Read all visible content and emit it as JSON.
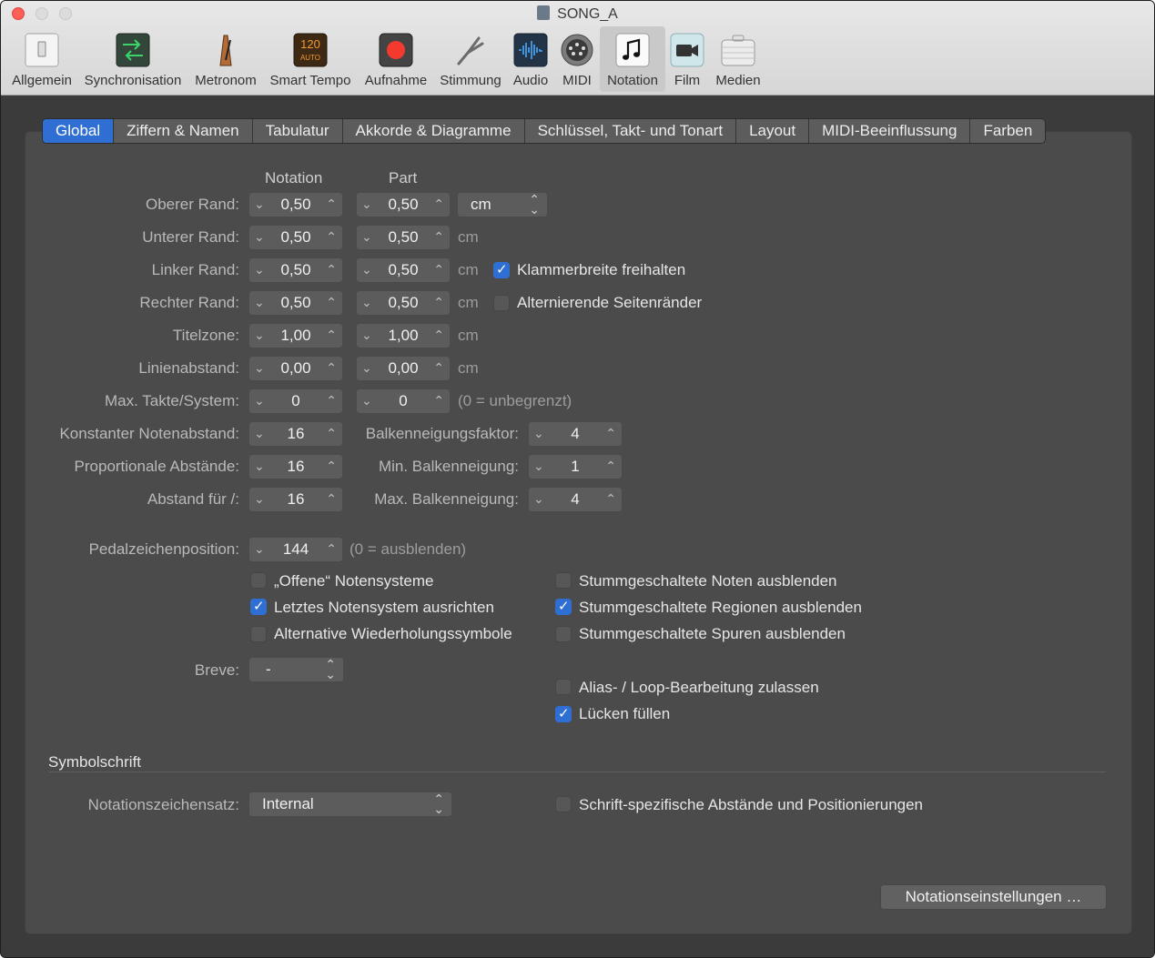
{
  "window": {
    "title": "SONG_A"
  },
  "toolbar": {
    "items": [
      {
        "label": "Allgemein",
        "icon": "general-switch-icon"
      },
      {
        "label": "Synchronisation",
        "icon": "sync-arrows-icon"
      },
      {
        "label": "Metronom",
        "icon": "metronome-icon"
      },
      {
        "label": "Smart Tempo",
        "icon": "smart-tempo-icon",
        "icon_text": "120",
        "icon_subtext": "AUTO"
      },
      {
        "label": "Aufnahme",
        "icon": "record-icon"
      },
      {
        "label": "Stimmung",
        "icon": "tuning-fork-icon"
      },
      {
        "label": "Audio",
        "icon": "audio-waveform-icon"
      },
      {
        "label": "MIDI",
        "icon": "midi-connector-icon"
      },
      {
        "label": "Notation",
        "icon": "music-note-icon"
      },
      {
        "label": "Film",
        "icon": "movie-camera-icon"
      },
      {
        "label": "Medien",
        "icon": "media-briefcase-icon"
      }
    ],
    "active": "Notation"
  },
  "tabs": [
    "Global",
    "Ziffern & Namen",
    "Tabulatur",
    "Akkorde & Diagramme",
    "Schlüssel, Takt- und Tonart",
    "Layout",
    "MIDI-Beeinflussung",
    "Farben"
  ],
  "selected_tab": "Global",
  "columns": {
    "notation": "Notation",
    "part": "Part"
  },
  "margins": [
    {
      "label": "Oberer Rand:",
      "notation": "0,50",
      "part": "0,50",
      "unit": "cm"
    },
    {
      "label": "Unterer Rand:",
      "notation": "0,50",
      "part": "0,50",
      "unit": "cm"
    },
    {
      "label": "Linker Rand:",
      "notation": "0,50",
      "part": "0,50",
      "unit": "cm"
    },
    {
      "label": "Rechter Rand:",
      "notation": "0,50",
      "part": "0,50",
      "unit": "cm"
    },
    {
      "label": "Titelzone:",
      "notation": "1,00",
      "part": "1,00",
      "unit": "cm"
    },
    {
      "label": "Linienabstand:",
      "notation": "0,00",
      "part": "0,00",
      "unit": "cm"
    },
    {
      "label": "Max. Takte/System:",
      "notation": "0",
      "part": "0",
      "unit": "(0 = unbegrenzt)"
    }
  ],
  "unit_popup": "cm",
  "bracket_checkbox": {
    "label": "Klammerbreite freihalten",
    "checked": true
  },
  "alternating_checkbox": {
    "label": "Alternierende Seitenränder",
    "checked": false
  },
  "spacing": [
    {
      "label": "Konstanter Notenabstand:",
      "value": "16"
    },
    {
      "label": "Proportionale Abstände:",
      "value": "16"
    },
    {
      "label": "Abstand für /:",
      "value": "16"
    }
  ],
  "beam": [
    {
      "label": "Balkenneigungsfaktor:",
      "value": "4"
    },
    {
      "label": "Min. Balkenneigung:",
      "value": "1"
    },
    {
      "label": "Max. Balkenneigung:",
      "value": "4"
    }
  ],
  "pedal": {
    "label": "Pedalzeichenposition:",
    "value": "144",
    "hint": "(0 = ausblenden)"
  },
  "left_checks": [
    {
      "label": "„Offene“ Notensysteme",
      "checked": false
    },
    {
      "label": "Letztes Notensystem ausrichten",
      "checked": true
    },
    {
      "label": "Alternative Wiederholungssymbole",
      "checked": false
    }
  ],
  "right_checks": [
    {
      "label": "Stummgeschaltete Noten ausblenden",
      "checked": false
    },
    {
      "label": "Stummgeschaltete Regionen ausblenden",
      "checked": true
    },
    {
      "label": "Stummgeschaltete Spuren ausblenden",
      "checked": false
    }
  ],
  "breve": {
    "label": "Breve:",
    "value": "-"
  },
  "extra_checks": [
    {
      "label": "Alias- / Loop-Bearbeitung zulassen",
      "checked": false
    },
    {
      "label": "Lücken füllen",
      "checked": true
    }
  ],
  "symbol_font": {
    "heading": "Symbolschrift",
    "label": "Notationszeichensatz:",
    "value": "Internal",
    "check_label": "Schrift-spezifische Abstände und Positionierungen",
    "checked": false
  },
  "settings_button": "Notationseinstellungen …"
}
